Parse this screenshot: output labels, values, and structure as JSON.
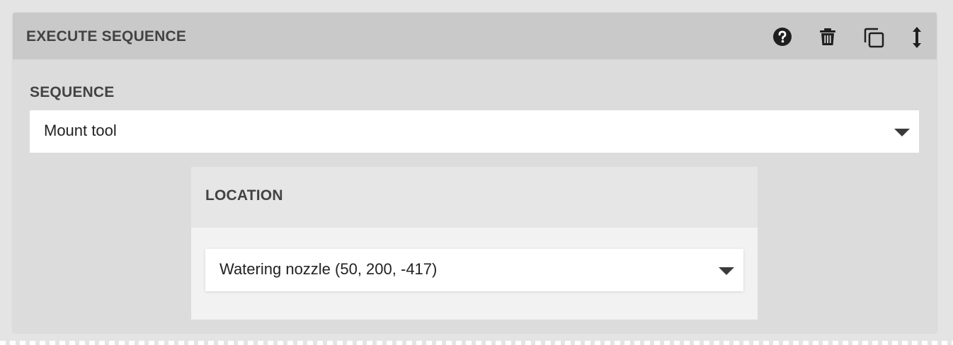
{
  "card": {
    "title": "EXECUTE SEQUENCE",
    "icons": [
      "help-icon",
      "trash-icon",
      "duplicate-icon",
      "drag-handle-icon"
    ]
  },
  "sequence": {
    "label": "SEQUENCE",
    "selected": "Mount tool"
  },
  "location": {
    "label": "LOCATION",
    "selected": "Watering nozzle (50, 200, -417)"
  },
  "colors": {
    "header_bg": "#c9c9c9",
    "card_bg": "#dcdcdc",
    "text": "#434343"
  }
}
